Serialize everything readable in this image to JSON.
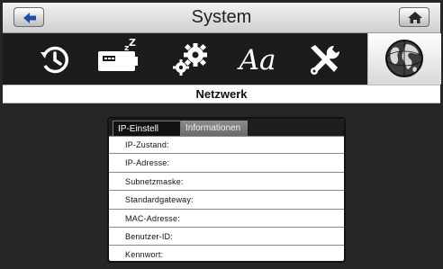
{
  "window": {
    "title": "System"
  },
  "header": {
    "back_icon": "back-arrow-icon",
    "home_icon": "home-icon"
  },
  "tabs": [
    {
      "icon": "clock-history-icon",
      "active": false
    },
    {
      "icon": "battery-sleep-icon",
      "active": false
    },
    {
      "icon": "gears-icon",
      "active": false
    },
    {
      "icon": "font-aa-icon",
      "label": "Aa",
      "active": false
    },
    {
      "icon": "tools-icon",
      "active": false
    },
    {
      "icon": "globe-network-icon",
      "active": true
    }
  ],
  "section": {
    "title": "Netzwerk"
  },
  "panel": {
    "tabs": [
      {
        "label": "IP-Einstell ungen",
        "active": true
      },
      {
        "label": "Informationen",
        "active": false
      }
    ],
    "rows": [
      {
        "label": "IP-Zustand:"
      },
      {
        "label": "IP-Adresse:"
      },
      {
        "label": "Subnetzmaske:"
      },
      {
        "label": "Standardgateway:"
      },
      {
        "label": "MAC-Adresse:"
      },
      {
        "label": "Benutzer-ID:"
      },
      {
        "label": "Kennwort:"
      }
    ]
  },
  "colors": {
    "background": "#262626",
    "tabbar": "#1b1b1b",
    "active_tab": "#ffffff",
    "panel": "#ffffff"
  }
}
